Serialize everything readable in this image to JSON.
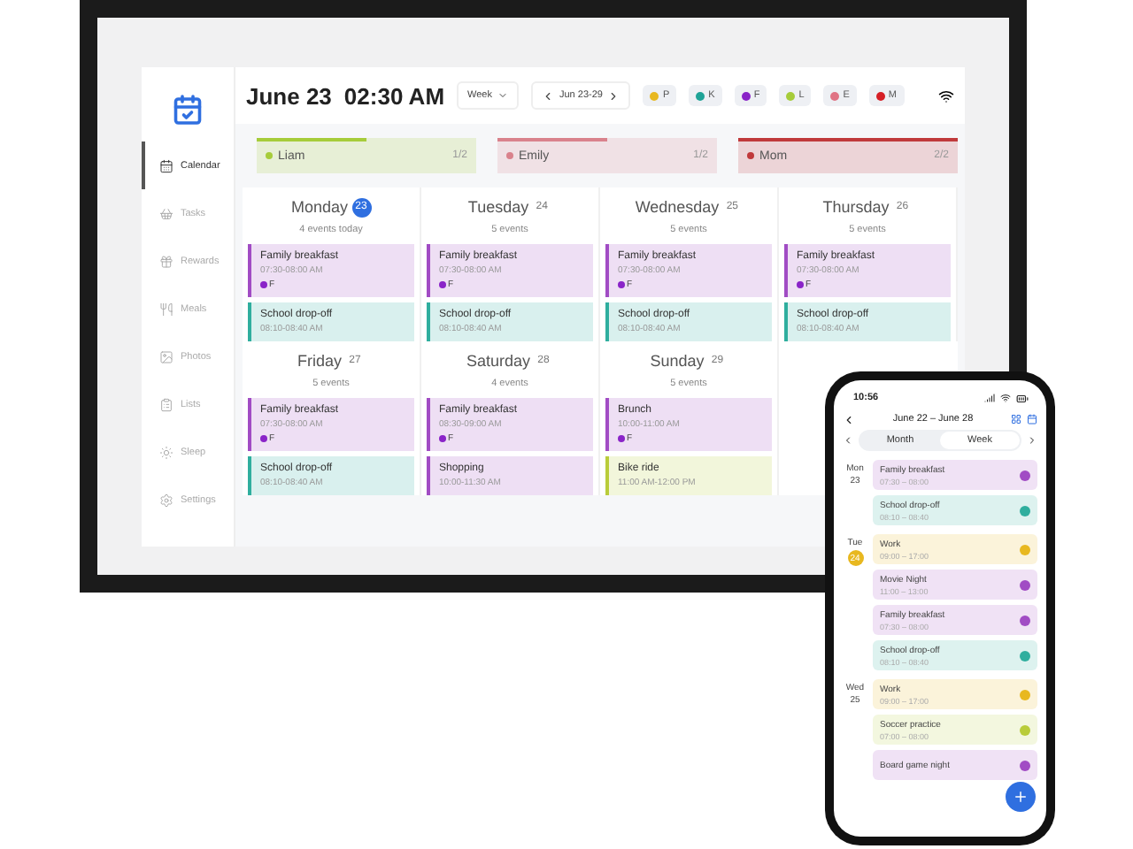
{
  "header": {
    "date": "June 23",
    "time": "02:30 AM",
    "view": "Week",
    "range": "Jun 23-29",
    "members": [
      {
        "initial": "P",
        "color": "#e8b820"
      },
      {
        "initial": "K",
        "color": "#1fa397"
      },
      {
        "initial": "F",
        "color": "#8a24c8"
      },
      {
        "initial": "L",
        "color": "#a6cc3a"
      },
      {
        "initial": "E",
        "color": "#e07384"
      },
      {
        "initial": "M",
        "color": "#d61f26"
      }
    ]
  },
  "sidebar": {
    "items": [
      {
        "label": "Calendar",
        "selected": true
      },
      {
        "label": "Tasks",
        "selected": false
      },
      {
        "label": "Rewards",
        "selected": false
      },
      {
        "label": "Meals",
        "selected": false
      },
      {
        "label": "Photos",
        "selected": false
      },
      {
        "label": "Lists",
        "selected": false
      },
      {
        "label": "Sleep",
        "selected": false
      },
      {
        "label": "Settings",
        "selected": false
      }
    ]
  },
  "progress": [
    {
      "name": "Liam",
      "count": "1/2",
      "color": "#a6cc3a",
      "level": 0.5
    },
    {
      "name": "Emily",
      "count": "1/2",
      "color": "#d9828c",
      "level": 0.5
    },
    {
      "name": "Mom",
      "count": "2/2",
      "color": "#c0393b",
      "level": 1
    }
  ],
  "days": [
    {
      "name": "Monday",
      "date": "23",
      "today": true,
      "count": "4 events today",
      "events": [
        {
          "title": "Family breakfast",
          "time": "07:30-08:00 AM",
          "member": {
            "initial": "F",
            "color": "#8a24c8"
          },
          "color": "#a14cc4"
        },
        {
          "title": "School drop-off",
          "time": "08:10-08:40 AM",
          "color": "#2fae9e"
        }
      ]
    },
    {
      "name": "Tuesday",
      "date": "24",
      "today": false,
      "count": "5 events",
      "events": [
        {
          "title": "Family breakfast",
          "time": "07:30-08:00 AM",
          "member": {
            "initial": "F",
            "color": "#8a24c8"
          },
          "color": "#a14cc4"
        },
        {
          "title": "School drop-off",
          "time": "08:10-08:40 AM",
          "color": "#2fae9e"
        }
      ]
    },
    {
      "name": "Wednesday",
      "date": "25",
      "today": false,
      "count": "5 events",
      "events": [
        {
          "title": "Family breakfast",
          "time": "07:30-08:00 AM",
          "member": {
            "initial": "F",
            "color": "#8a24c8"
          },
          "color": "#a14cc4"
        },
        {
          "title": "School drop-off",
          "time": "08:10-08:40 AM",
          "color": "#2fae9e"
        }
      ]
    },
    {
      "name": "Thursday",
      "date": "26",
      "today": false,
      "count": "5 events",
      "events": [
        {
          "title": "Family breakfast",
          "time": "07:30-08:00 AM",
          "member": {
            "initial": "F",
            "color": "#8a24c8"
          },
          "color": "#a14cc4"
        },
        {
          "title": "School drop-off",
          "time": "08:10-08:40 AM",
          "color": "#2fae9e"
        }
      ]
    },
    {
      "name": "Friday",
      "date": "27",
      "today": false,
      "count": "5 events",
      "events": [
        {
          "title": "Family breakfast",
          "time": "07:30-08:00 AM",
          "member": {
            "initial": "F",
            "color": "#8a24c8"
          },
          "color": "#a14cc4"
        },
        {
          "title": "School drop-off",
          "time": "08:10-08:40 AM",
          "color": "#2fae9e"
        }
      ]
    },
    {
      "name": "Saturday",
      "date": "28",
      "today": false,
      "count": "4 events",
      "events": [
        {
          "title": "Family breakfast",
          "time": "08:30-09:00 AM",
          "member": {
            "initial": "F",
            "color": "#8a24c8"
          },
          "color": "#a14cc4"
        },
        {
          "title": "Shopping",
          "time": "10:00-11:30 AM",
          "color": "#a14cc4"
        }
      ]
    },
    {
      "name": "Sunday",
      "date": "29",
      "today": false,
      "count": "5 events",
      "events": [
        {
          "title": "Brunch",
          "time": "10:00-11:00 AM",
          "member": {
            "initial": "F",
            "color": "#8a24c8"
          },
          "color": "#a14cc4"
        },
        {
          "title": "Bike ride",
          "time": "11:00 AM-12:00 PM",
          "color": "#b9cc3a"
        }
      ]
    }
  ],
  "phone": {
    "clock": "10:56",
    "range": "June 22 – June 28",
    "modes": [
      {
        "label": "Month",
        "selected": false
      },
      {
        "label": "Week",
        "selected": true
      }
    ],
    "days": [
      {
        "weekday": "Mon",
        "date": "23",
        "highlighted": false,
        "events": [
          {
            "title": "Family breakfast",
            "time": "07:30 – 08:00",
            "color": "#a14cc4"
          },
          {
            "title": "School drop-off",
            "time": "08:10 – 08:40",
            "color": "#2fae9e"
          }
        ]
      },
      {
        "weekday": "Tue",
        "date": "24",
        "highlighted": true,
        "events": [
          {
            "title": "Work",
            "time": "09:00 – 17:00",
            "color": "#e8b820"
          },
          {
            "title": "Movie Night",
            "time": "11:00 – 13:00",
            "color": "#a14cc4"
          },
          {
            "title": "Family breakfast",
            "time": "07:30 – 08:00",
            "color": "#a14cc4"
          },
          {
            "title": "School drop-off",
            "time": "08:10 – 08:40",
            "color": "#2fae9e"
          }
        ]
      },
      {
        "weekday": "Wed",
        "date": "25",
        "highlighted": false,
        "events": [
          {
            "title": "Work",
            "time": "09:00 – 17:00",
            "color": "#e8b820"
          },
          {
            "title": "Soccer practice",
            "time": "07:00 – 08:00",
            "color": "#b9cc3a"
          },
          {
            "title": "Board game night",
            "color": "#a14cc4"
          }
        ]
      }
    ]
  }
}
